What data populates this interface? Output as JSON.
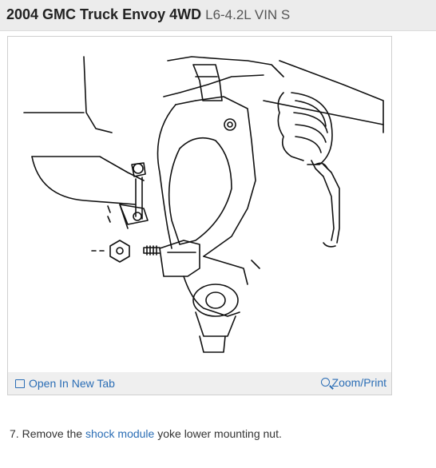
{
  "header": {
    "title": "2004 GMC Truck Envoy 4WD",
    "engine": "L6-4.2L VIN S"
  },
  "figure": {
    "open_tab_label": "Open In New Tab",
    "open_tab_icon": "open-tab-icon",
    "zoom_label": "Zoom/Print",
    "zoom_icon": "magnifier-icon"
  },
  "instruction": {
    "number": "7.",
    "text_before": "Remove the",
    "link_text": "shock module",
    "text_after": "yoke lower mounting nut."
  }
}
